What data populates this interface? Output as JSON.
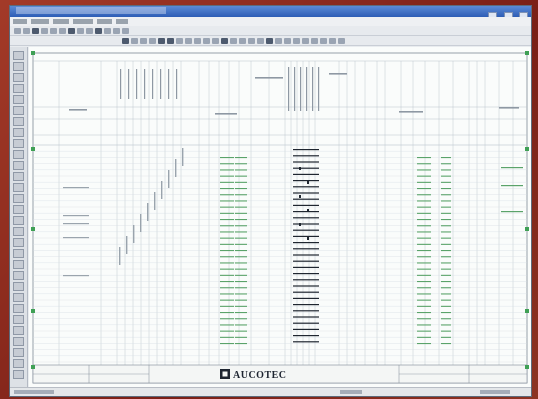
{
  "title_block": {
    "logo_text": "AUCOTEC"
  },
  "colors": {
    "window_frame": "#5d6a7a",
    "titlebar": "#2d5db5",
    "sheet_background": "#fafcfb",
    "grid_lines": "#b9c4cc",
    "green_entries": "#5aa36a",
    "dark_entries": "#1f2630",
    "corner_markers": "#3fa055"
  },
  "icons": [
    "window-minimize-icon",
    "window-maximize-icon",
    "window-close-icon",
    "toolbar-tool-icon",
    "sheet-corner-marker-icon",
    "aucotec-logo-icon"
  ]
}
